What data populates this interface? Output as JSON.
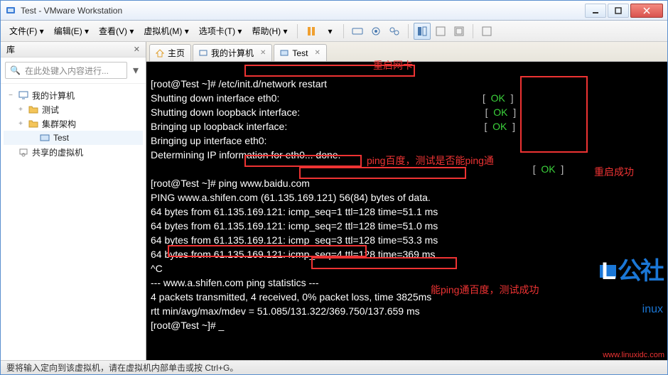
{
  "title": "Test - VMware Workstation",
  "menu": {
    "file": "文件(F)",
    "edit": "编辑(E)",
    "view": "查看(V)",
    "vm": "虚拟机(M)",
    "tabs": "选项卡(T)",
    "help": "帮助(H)"
  },
  "sidebar": {
    "heading": "库",
    "search_placeholder": "在此处键入内容进行...",
    "items": [
      {
        "label": "我的计算机",
        "type": "root",
        "exp": "−"
      },
      {
        "label": "测试",
        "type": "folder",
        "exp": "+"
      },
      {
        "label": "集群架构",
        "type": "folder",
        "exp": "+"
      },
      {
        "label": "Test",
        "type": "vm"
      },
      {
        "label": "共享的虚拟机",
        "type": "shared"
      }
    ]
  },
  "tabs": [
    {
      "icon": "home",
      "label": "主页"
    },
    {
      "icon": "pc",
      "label": "我的计算机"
    },
    {
      "icon": "vm",
      "label": "Test",
      "active": true
    }
  ],
  "annotations": {
    "a1": "重启网卡",
    "a2": "ping百度，测试是否能ping通",
    "a3": "重启成功",
    "a4": "能ping通百度，测试成功"
  },
  "terminal": {
    "l1": "[root@Test ~]# /etc/init.d/network restart",
    "l2": "Shutting down interface eth0:",
    "l3": "Shutting down loopback interface:",
    "l4": "Bringing up loopback interface:",
    "l5": "Bringing up interface eth0:",
    "l6": "Determining IP information for eth0... done.",
    "l7": "",
    "l8": "[root@Test ~]# ping www.baidu.com",
    "l9": "PING www.a.shifen.com (61.135.169.121) 56(84) bytes of data.",
    "l10": "64 bytes from 61.135.169.121: icmp_seq=1 ttl=128 time=51.1 ms",
    "l11": "64 bytes from 61.135.169.121: icmp_seq=2 ttl=128 time=51.0 ms",
    "l12": "64 bytes from 61.135.169.121: icmp_seq=3 ttl=128 time=53.3 ms",
    "l13": "64 bytes from 61.135.169.121: icmp_seq=4 ttl=128 time=369 ms",
    "l14": "^C",
    "l15": "--- www.a.shifen.com ping statistics ---",
    "l16": "4 packets transmitted, 4 received, 0% packet loss, time 3825ms",
    "l17": "rtt min/avg/max/mdev = 51.085/131.322/369.750/137.659 ms",
    "l18": "[root@Test ~]# _",
    "ok": "OK",
    "lbr": "[  ",
    "rbr": "  ]"
  },
  "status": "要将输入定向到该虚拟机，请在虚拟机内部单击或按 Ctrl+G。",
  "watermark": {
    "brand1": "L",
    "brand2": "公社",
    "sub": "inux",
    "url": "www.linuxidc.com"
  }
}
